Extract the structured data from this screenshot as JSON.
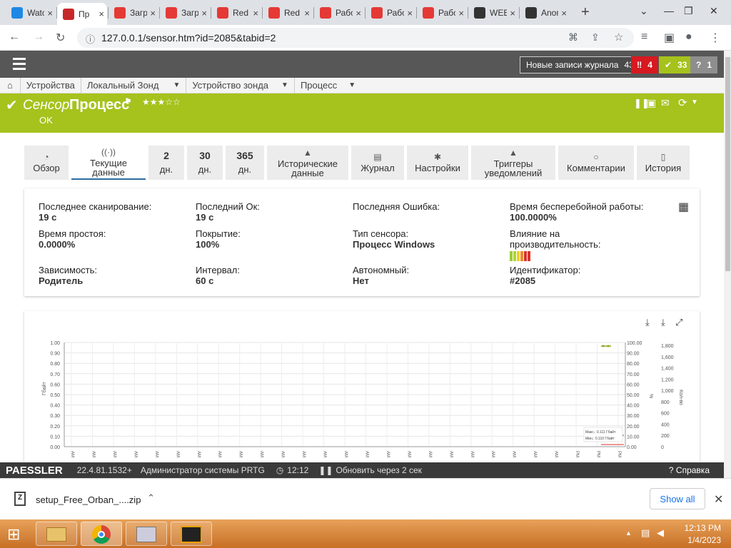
{
  "browser": {
    "tabs": [
      {
        "label": "Watch",
        "color": "#1e88e5"
      },
      {
        "label": "Пр",
        "color": "#c62828",
        "active": true
      },
      {
        "label": "Загру",
        "color": "#e53935"
      },
      {
        "label": "Загру",
        "color": "#e53935"
      },
      {
        "label": "Red H",
        "color": "#e53935"
      },
      {
        "label": "Red H",
        "color": "#e53935"
      },
      {
        "label": "Работ",
        "color": "#e53935"
      },
      {
        "label": "Работ",
        "color": "#e53935"
      },
      {
        "label": "Работ",
        "color": "#e53935"
      },
      {
        "label": "WEB",
        "color": "#333333"
      },
      {
        "label": "Anony",
        "color": "#333333"
      }
    ],
    "new_tab": "+",
    "url": "127.0.0.1/sensor.htm?id=2085&tabid=2"
  },
  "prtg": {
    "new_log_label": "Новые записи журнала",
    "new_log_count": "43",
    "alarm_count": "4",
    "ok_count": "33",
    "unknown_count": "1",
    "unknown_mark": "?",
    "breadcrumbs": [
      "Устройства",
      "Локальный Зонд",
      "Устройство зонда",
      "Процесс"
    ],
    "sensor_word": "Сенсор",
    "sensor_name": "Процесс",
    "stars": "★★★☆☆",
    "status": "OK",
    "tabs": [
      {
        "icon": "◔",
        "label": "Обзор"
      },
      {
        "icon": "((·))",
        "label": "Текущие данные",
        "selected": true
      },
      {
        "big": "2",
        "label": "дн."
      },
      {
        "big": "30",
        "label": "дн."
      },
      {
        "big": "365",
        "label": "дн."
      },
      {
        "icon": "▲",
        "label": "Исторические данные"
      },
      {
        "icon": "▤",
        "label": "Журнал"
      },
      {
        "icon": "✱",
        "label": "Настройки"
      },
      {
        "icon": "▲",
        "label": "Триггеры уведомлений"
      },
      {
        "icon": "○",
        "label": "Комментарии"
      },
      {
        "icon": "▯",
        "label": "История"
      }
    ],
    "fields": [
      {
        "label": "Последнее сканирование:",
        "value": "19 с"
      },
      {
        "label": "Последний Ок:",
        "value": "19 с"
      },
      {
        "label": "Последняя Ошибка:",
        "value": ""
      },
      {
        "label": "Время бесперебойной работы:",
        "value": "100.0000%"
      },
      {
        "label": "Время простоя:",
        "value": "0.0000%"
      },
      {
        "label": "Покрытие:",
        "value": "100%"
      },
      {
        "label": "Тип сенсора:",
        "value": "Процесс Windows"
      },
      {
        "label": "Влияние на производительность:",
        "value": ""
      },
      {
        "label": "Зависимость:",
        "value": "Родитель"
      },
      {
        "label": "Интервал:",
        "value": "60 с"
      },
      {
        "label": "Автономный:",
        "value": "Нет"
      },
      {
        "label": "Идентификатор:",
        "value": "#2085"
      }
    ],
    "footer": {
      "brand": "PAESSLER",
      "version": "22.4.81.1532+",
      "user": "Администратор системы PRTG",
      "time": "12:12",
      "refresh": "Обновить через 2 сек",
      "help": "? Справка"
    }
  },
  "chart_data": {
    "type": "line",
    "left_axis": {
      "label": "Гбайт",
      "ticks": [
        "1.00",
        "0.90",
        "0.80",
        "0.70",
        "0.60",
        "0.50",
        "0.40",
        "0.30",
        "0.20",
        "0.10",
        "0.00"
      ],
      "ylim": [
        0,
        1
      ]
    },
    "right_axis_1": {
      "label": "%",
      "ticks": [
        "100.00",
        "90.00",
        "80.00",
        "70.00",
        "60.00",
        "50.00",
        "40.00",
        "30.00",
        "20.00",
        "10.00",
        "0.00"
      ],
      "ylim": [
        0,
        100
      ]
    },
    "right_axis_2": {
      "label": "Кол-во",
      "ticks": [
        "1,800",
        "1,600",
        "1,400",
        "1,200",
        "1,000",
        "800",
        "600",
        "400",
        "200",
        "0"
      ],
      "ylim": [
        0,
        1800
      ]
    },
    "x_tick_labels": [
      "AM",
      "AM",
      "AM",
      "AM",
      "AM",
      "AM",
      "AM",
      "AM",
      "AM",
      "AM",
      "AM",
      "AM",
      "AM",
      "AM",
      "AM",
      "AM",
      "AM",
      "AM",
      "AM",
      "AM",
      "AM",
      "AM",
      "AM",
      "AM",
      "PM",
      "PM",
      "PM"
    ],
    "annotations": [
      "Макс.: 0.111 Гбайт",
      "Мин.: 0.110 Гбайт"
    ],
    "grid": true,
    "legend": "none"
  },
  "downloads": {
    "file": "setup_Free_Orban_....zip",
    "show_all": "Show all"
  },
  "taskbar": {
    "time": "12:13 PM",
    "date": "1/4/2023"
  }
}
